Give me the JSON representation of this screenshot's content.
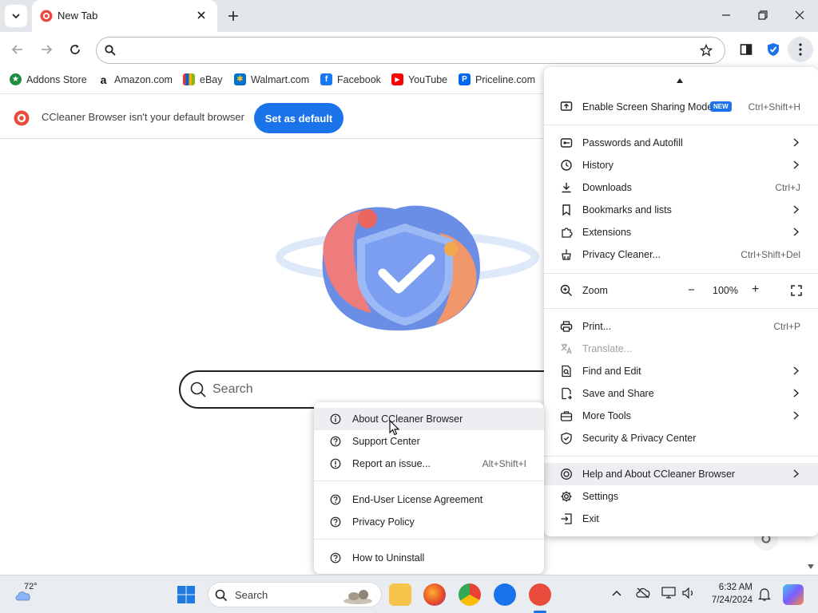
{
  "tab": {
    "title": "New Tab"
  },
  "bookmarks": [
    {
      "label": "Addons Store",
      "icon": "addons-icon",
      "color": "#1e8e3e"
    },
    {
      "label": "Amazon.com",
      "icon": "amazon-icon",
      "color": "#111111"
    },
    {
      "label": "eBay",
      "icon": "ebay-icon",
      "color": "#e53238"
    },
    {
      "label": "Walmart.com",
      "icon": "walmart-icon",
      "color": "#0071ce"
    },
    {
      "label": "Facebook",
      "icon": "facebook-icon",
      "color": "#1877f2"
    },
    {
      "label": "YouTube",
      "icon": "youtube-icon",
      "color": "#ff0000"
    },
    {
      "label": "Priceline.com",
      "icon": "priceline-icon",
      "color": "#0068ef"
    }
  ],
  "infobar": {
    "message": "CCleaner Browser isn't your default browser",
    "button": "Set as default"
  },
  "page": {
    "search_placeholder": "Search"
  },
  "menu": {
    "screen_sharing": {
      "label": "Enable Screen Sharing Mode",
      "badge": "NEW",
      "shortcut": "Ctrl+Shift+H"
    },
    "passwords": {
      "label": "Passwords and Autofill"
    },
    "history": {
      "label": "History"
    },
    "downloads": {
      "label": "Downloads",
      "shortcut": "Ctrl+J"
    },
    "bookmarks": {
      "label": "Bookmarks and lists"
    },
    "extensions": {
      "label": "Extensions"
    },
    "privacy_cleaner": {
      "label": "Privacy Cleaner...",
      "shortcut": "Ctrl+Shift+Del"
    },
    "zoom": {
      "label": "Zoom",
      "minus": "−",
      "value": "100%",
      "plus": "+"
    },
    "print": {
      "label": "Print...",
      "shortcut": "Ctrl+P"
    },
    "translate": {
      "label": "Translate..."
    },
    "find_edit": {
      "label": "Find and Edit"
    },
    "save_share": {
      "label": "Save and Share"
    },
    "more_tools": {
      "label": "More Tools"
    },
    "security_center": {
      "label": "Security & Privacy Center"
    },
    "help_about": {
      "label": "Help and About CCleaner Browser"
    },
    "settings": {
      "label": "Settings"
    },
    "exit": {
      "label": "Exit"
    }
  },
  "submenu": {
    "about": {
      "label": "About CCleaner Browser"
    },
    "support": {
      "label": "Support Center"
    },
    "report": {
      "label": "Report an issue...",
      "shortcut": "Alt+Shift+I"
    },
    "eula": {
      "label": "End-User License Agreement"
    },
    "privacy_policy": {
      "label": "Privacy Policy"
    },
    "uninstall": {
      "label": "How to Uninstall"
    }
  },
  "taskbar": {
    "weather": "72°",
    "search": "Search",
    "time": "6:32 AM",
    "date": "7/24/2024"
  },
  "colors": {
    "accent": "#1a73e8",
    "brand": "#e94b3c"
  }
}
